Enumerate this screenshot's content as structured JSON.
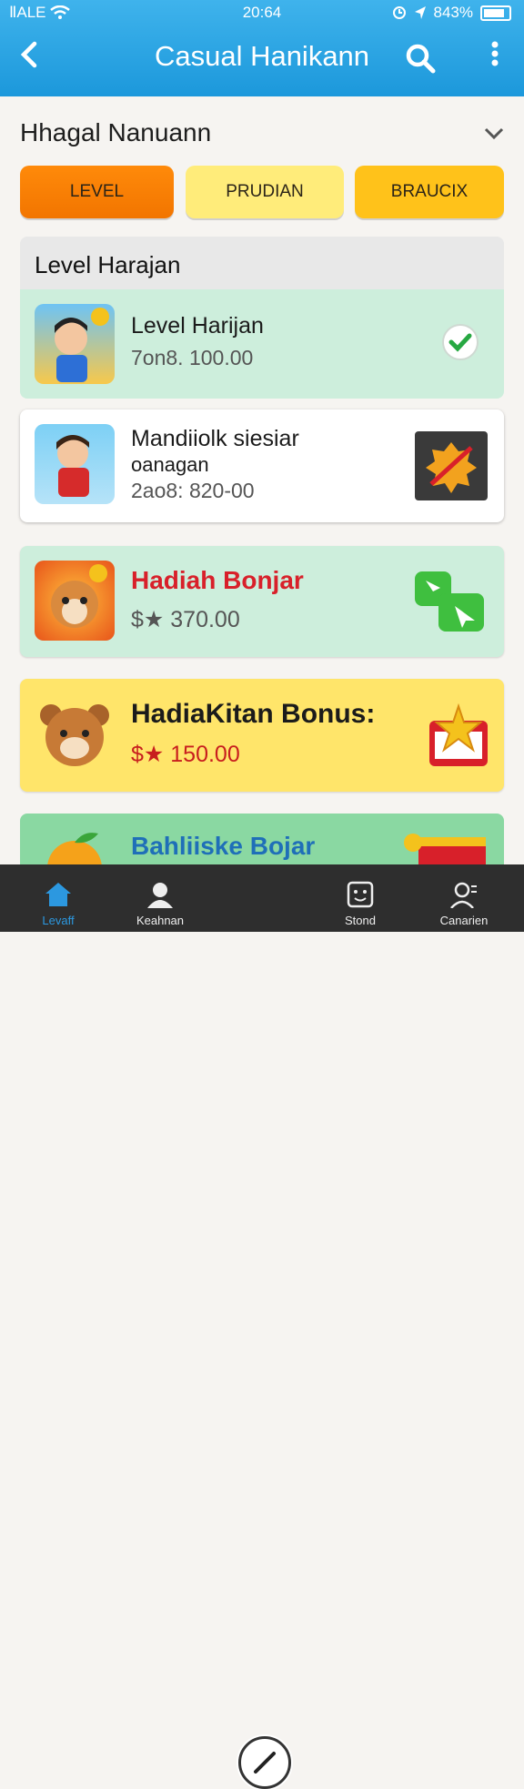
{
  "status_bar": {
    "carrier": "ⅡALE",
    "time": "20:64",
    "battery": "843%"
  },
  "header": {
    "title": "Casual Hanikann"
  },
  "section": {
    "title": "Hhagal Nanuann"
  },
  "filters": [
    "LEVEL",
    "PRUDIAN",
    "BRAUCIX"
  ],
  "list": {
    "header": "Level Harajan",
    "items": [
      {
        "title": "Level Harijan",
        "subtitle": "7on8. 100.00",
        "status_icon": "check-icon"
      },
      {
        "title": "Mandiiolk siesiar",
        "title2": "oanagan",
        "subtitle": "2ao8: 820-00",
        "status_icon": "badge-icon"
      },
      {
        "title": "Hadiah Bonjar",
        "subtitle": "$★ 370.00",
        "status_icon": "cursor-icon"
      },
      {
        "title": "HadiaKitan Bonus:",
        "subtitle": "$★ 150.00",
        "status_icon": "gift-icon"
      },
      {
        "title": "Bahliiske Bojar"
      }
    ]
  },
  "colors": {
    "accent": "#1c98db",
    "red_title": "#d8202a",
    "bonus_value": "#c81e1e"
  },
  "tabs": [
    {
      "label": "Levaff",
      "icon": "home-icon"
    },
    {
      "label": "Keahnan",
      "icon": "profile-icon"
    },
    {
      "label": "",
      "icon": "pencil-icon"
    },
    {
      "label": "Stond",
      "icon": "face-icon"
    },
    {
      "label": "Canarien",
      "icon": "user-icon"
    }
  ]
}
